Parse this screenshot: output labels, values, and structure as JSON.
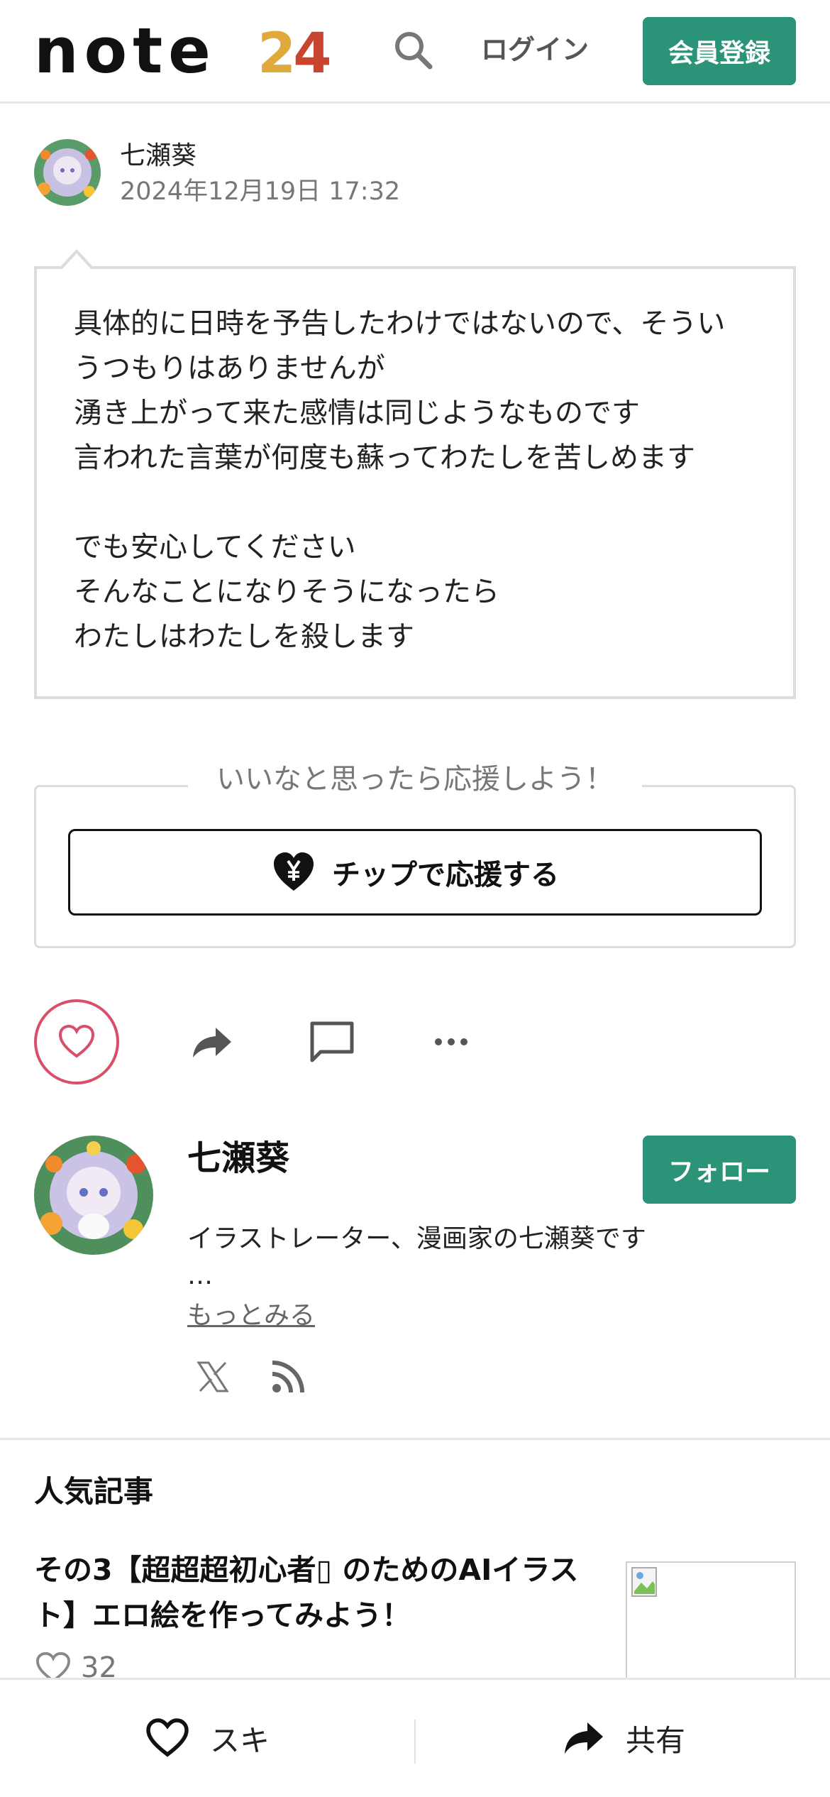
{
  "header": {
    "logo_text": "note",
    "logo_badge_2": "2",
    "logo_badge_4": "4",
    "search_icon": "search-icon",
    "login_label": "ログイン",
    "signup_label": "会員登録",
    "brand_color": "#2b9478"
  },
  "post": {
    "author": "七瀬葵",
    "date": "2024年12月19日 17:32",
    "body": "具体的に日時を予告したわけではないので、そうい\nうつもりはありませんが\n湧き上がって来た感情は同じようなものです\n言われた言葉が何度も蘇ってわたしを苦しめます\n\nでも安心してください\nそんなことになりそうになったら\nわたしはわたしを殺します"
  },
  "support": {
    "caption": "いいなと思ったら応援しよう！",
    "tip_label": "チップで応援する",
    "tip_icon": "heart-yen-icon"
  },
  "actions": {
    "like_icon": "heart-icon",
    "like_color": "#d94f6a",
    "share_icon": "share-icon",
    "comment_icon": "comment-icon",
    "more_icon": "more-icon"
  },
  "profile": {
    "name": "七瀬葵",
    "follow_label": "フォロー",
    "bio": "イラストレーター、漫画家の七瀬葵です",
    "ellipsis": "…",
    "more_label": "もっとみる",
    "x_icon": "x-icon",
    "rss_icon": "rss-icon"
  },
  "popular": {
    "heading": "人気記事",
    "articles": [
      {
        "title": "その3【超超超初心者▯ のためのAIイラスト】エロ絵を作ってみよう！",
        "likes": "32"
      }
    ]
  },
  "bottom_bar": {
    "like_label": "スキ",
    "share_label": "共有"
  }
}
